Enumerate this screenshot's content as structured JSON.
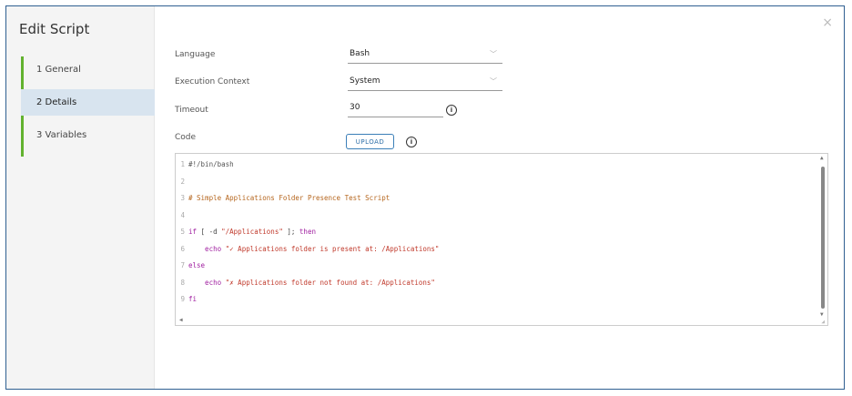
{
  "dialog": {
    "title": "Edit Script",
    "close_icon": "×"
  },
  "steps": [
    {
      "label": "1  General",
      "active": false
    },
    {
      "label": "2  Details",
      "active": true
    },
    {
      "label": "3  Variables",
      "active": false
    }
  ],
  "form": {
    "language": {
      "label": "Language",
      "value": "Bash"
    },
    "execution_context": {
      "label": "Execution Context",
      "value": "System"
    },
    "timeout": {
      "label": "Timeout",
      "value": "30"
    },
    "code": {
      "label": "Code",
      "upload_label": "UPLOAD"
    }
  },
  "code_lines": [
    {
      "n": "1",
      "parts": [
        {
          "t": "#!/bin/bash",
          "c": "shebang"
        }
      ]
    },
    {
      "n": "2",
      "parts": []
    },
    {
      "n": "3",
      "parts": [
        {
          "t": "# Simple Applications Folder Presence Test Script",
          "c": "comment"
        }
      ]
    },
    {
      "n": "4",
      "parts": []
    },
    {
      "n": "5",
      "parts": [
        {
          "t": "if",
          "c": "kw"
        },
        {
          "t": " [ -d ",
          "c": "plain"
        },
        {
          "t": "\"/Applications\"",
          "c": "str"
        },
        {
          "t": " ]; ",
          "c": "plain"
        },
        {
          "t": "then",
          "c": "kw"
        }
      ]
    },
    {
      "n": "6",
      "parts": [
        {
          "t": "    echo ",
          "c": "kw"
        },
        {
          "t": "\"✓ Applications folder is present at: /Applications\"",
          "c": "str"
        }
      ]
    },
    {
      "n": "7",
      "parts": [
        {
          "t": "else",
          "c": "kw"
        }
      ]
    },
    {
      "n": "8",
      "parts": [
        {
          "t": "    echo ",
          "c": "kw"
        },
        {
          "t": "\"✗ Applications folder not found at: /Applications\"",
          "c": "str"
        }
      ]
    },
    {
      "n": "9",
      "parts": [
        {
          "t": "fi",
          "c": "kw"
        }
      ]
    }
  ]
}
